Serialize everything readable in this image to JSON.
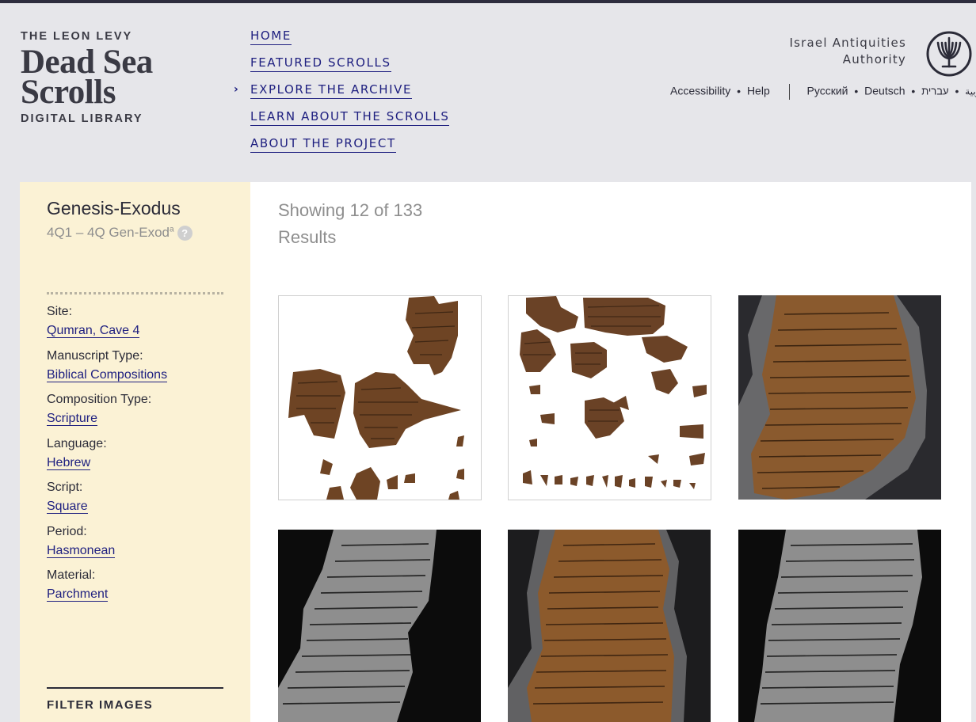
{
  "logo": {
    "line1": "THE LEON LEVY",
    "line2": "Dead Sea",
    "line3": "Scrolls",
    "line4": "DIGITAL LIBRARY"
  },
  "nav": {
    "items": [
      {
        "label": "HOME"
      },
      {
        "label": "FEATURED SCROLLS"
      },
      {
        "label": "EXPLORE THE ARCHIVE",
        "active": true
      },
      {
        "label": "LEARN ABOUT THE SCROLLS"
      },
      {
        "label": "ABOUT THE PROJECT"
      }
    ]
  },
  "authority": {
    "line1": "Israel Antiquities",
    "line2": "Authority",
    "emblem_icon": "menorah-emblem-icon"
  },
  "utility": {
    "accessibility": "Accessibility",
    "help": "Help",
    "languages": [
      "Русский",
      "Deutsch",
      "العربية",
      "עברית"
    ]
  },
  "sidebar": {
    "title": "Genesis-Exodus",
    "subtitle_prefix": "4Q1 –  4Q Gen-Exod",
    "subtitle_sup": "a",
    "help_icon": "?",
    "properties": [
      {
        "label": "Site:",
        "value": "Qumran, Cave 4"
      },
      {
        "label": "Manuscript Type:",
        "value": "Biblical Compositions"
      },
      {
        "label": "Composition Type:",
        "value": "Scripture"
      },
      {
        "label": "Language:",
        "value": "Hebrew"
      },
      {
        "label": "Script:",
        "value": "Square"
      },
      {
        "label": "Period:",
        "value": "Hasmonean"
      },
      {
        "label": "Material:",
        "value": "Parchment"
      }
    ],
    "filter_heading": "FILTER IMAGES"
  },
  "results": {
    "showing": "Showing 12 of 133",
    "results_word": "Results"
  },
  "colors": {
    "page_bg": "#e6e6ea",
    "sidebar_bg": "#fbf2d5",
    "link": "#1f2080",
    "muted": "#8e8e8e",
    "parchment": "#7a4a26",
    "dark_bg": "#111111"
  }
}
